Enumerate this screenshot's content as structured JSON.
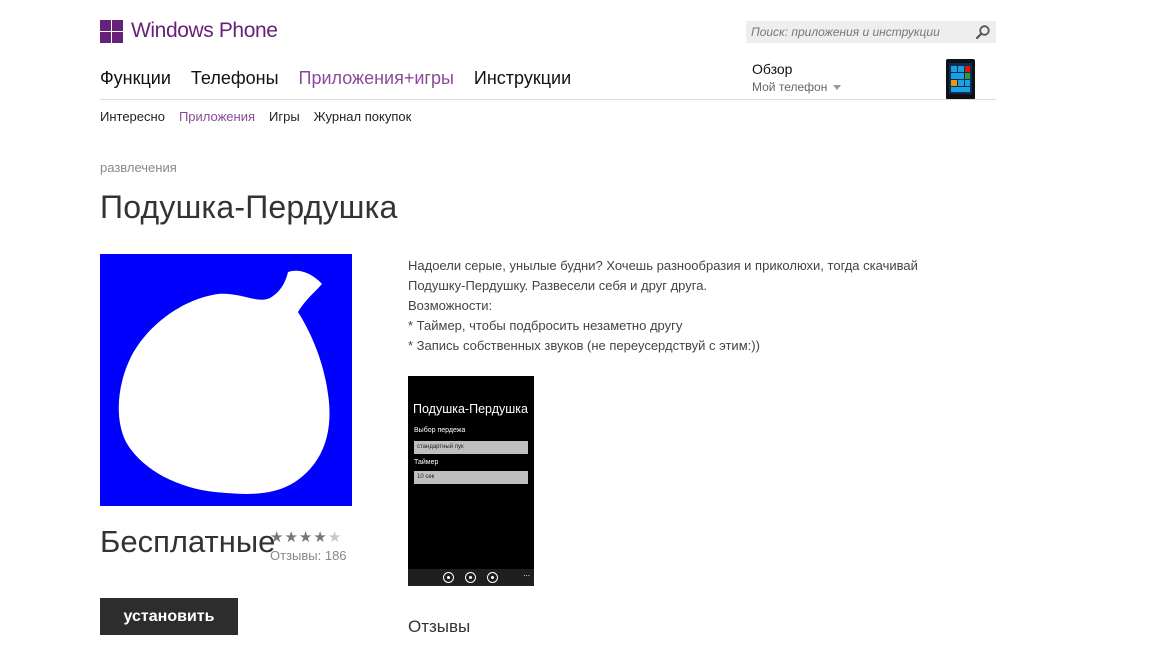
{
  "brand": {
    "name": "Windows Phone",
    "color": "#68217a"
  },
  "search": {
    "placeholder": "Поиск: приложения и инструкции",
    "icon": "search-icon"
  },
  "main_nav": {
    "items": [
      {
        "label": "Функции"
      },
      {
        "label": "Телефоны"
      },
      {
        "label": "Приложения+игры",
        "active": true
      },
      {
        "label": "Инструкции"
      }
    ]
  },
  "phone_selector": {
    "title": "Обзор",
    "subtitle": "Мой телефон",
    "icon": "phone-thumbnail"
  },
  "sub_nav": {
    "items": [
      {
        "label": "Интересно"
      },
      {
        "label": "Приложения",
        "active": true
      },
      {
        "label": "Игры"
      },
      {
        "label": "Журнал покупок"
      }
    ]
  },
  "app": {
    "category": "развлечения",
    "title": "Подушка-Пердушка",
    "icon_background": "#0000fe",
    "price": "Бесплатные",
    "rating": {
      "stars_filled": 4,
      "stars_total": 5,
      "reviews_label": "Отзывы: 186"
    },
    "install_label": "установить",
    "description_lines": [
      "Надоели серые, унылые будни? Хочешь разнообразия и приколюхи, тогда скачивай",
      "Подушку-Пердушку. Развесели себя и друг друга.",
      "Возможности:",
      "* Таймер, чтобы подбросить незаметно другу",
      "* Запись собственных звуков (не переусердствуй с этим:))"
    ],
    "screenshot": {
      "title": "Подушка-Пердушка",
      "label1": "Выбор пердежа",
      "field1": "стандартный пук",
      "label2": "Таймер",
      "field2": "10 сек",
      "appbar_more": "..."
    }
  },
  "reviews": {
    "heading": "Отзывы"
  },
  "colors": {
    "accent": "#8a4a97",
    "install_bg": "#2d2d2d"
  }
}
